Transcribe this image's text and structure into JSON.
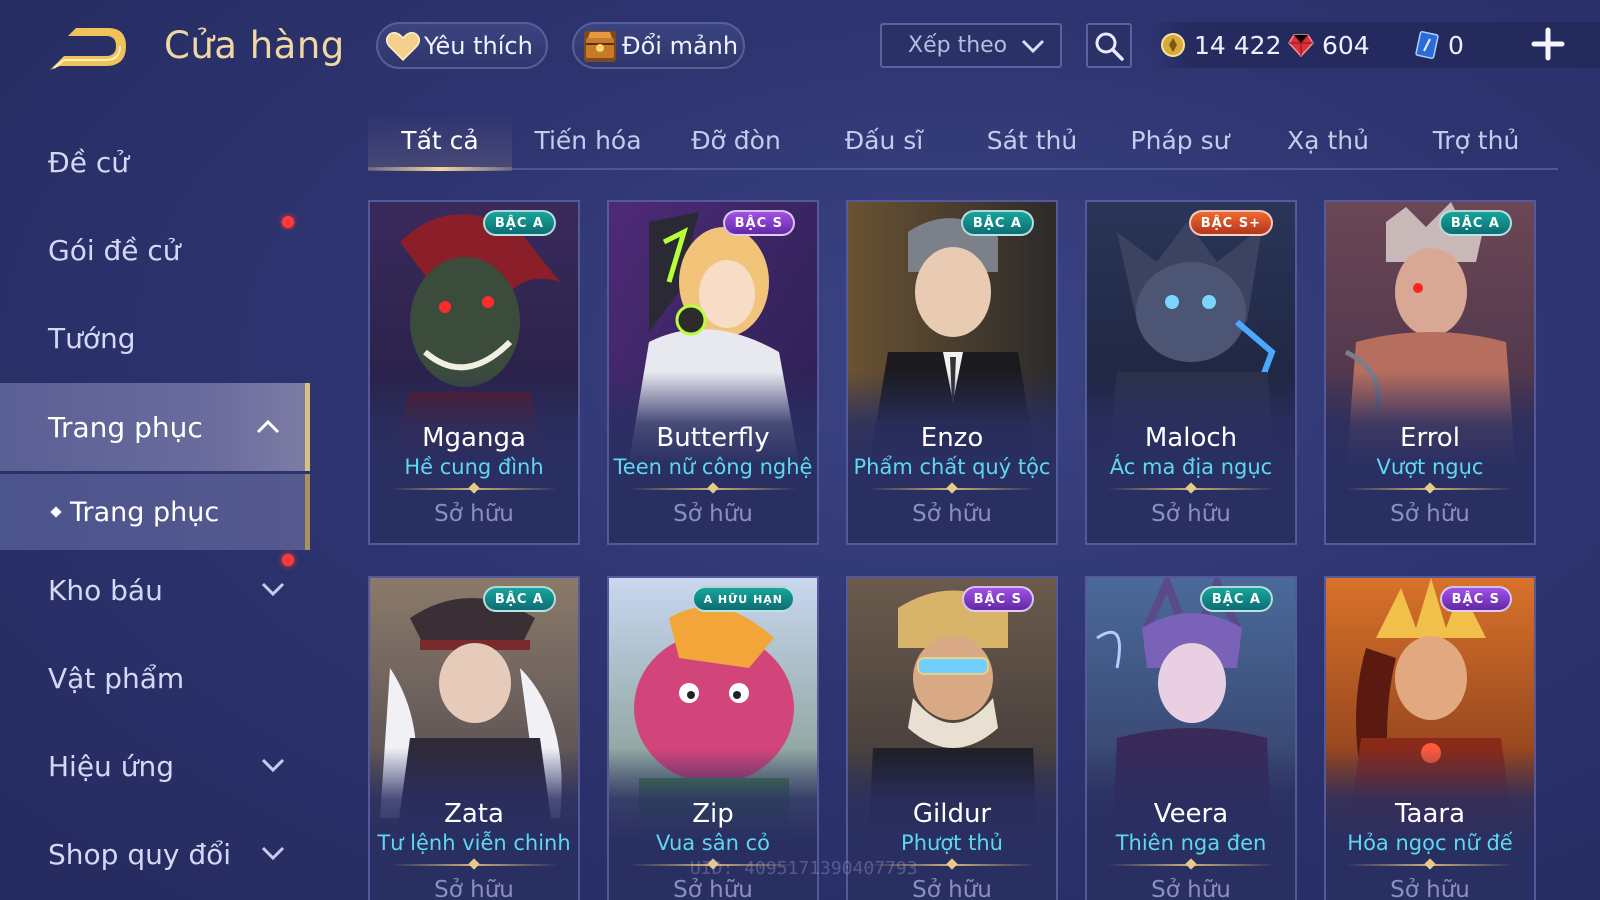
{
  "header": {
    "title": "Cửa hàng",
    "favorites_label": "Yêu thích",
    "fragments_label": "Đổi mảnh",
    "sort_placeholder": "Xếp theo",
    "gold": "14 422",
    "ruby": "604",
    "voucher": "0"
  },
  "sidebar": {
    "items": [
      {
        "label": "Đề cử"
      },
      {
        "label": "Gói đề cử"
      },
      {
        "label": "Tướng"
      },
      {
        "label": "Trang phục"
      },
      {
        "label": "Kho báu"
      },
      {
        "label": "Vật phẩm"
      },
      {
        "label": "Hiệu ứng"
      },
      {
        "label": "Shop quy đổi"
      }
    ],
    "sub_active": "Trang phục"
  },
  "tabs": [
    "Tất cả",
    "Tiến hóa",
    "Đỡ đòn",
    "Đấu sĩ",
    "Sát thủ",
    "Pháp sư",
    "Xạ thủ",
    "Trợ thủ"
  ],
  "cards": [
    {
      "hero": "Mganga",
      "skin": "Hề cung đình",
      "tier": "BẬC A",
      "status": "Sở hữu"
    },
    {
      "hero": "Butterfly",
      "skin": "Teen nữ công nghệ",
      "tier": "BẬC S",
      "status": "Sở hữu"
    },
    {
      "hero": "Enzo",
      "skin": "Phẩm chất quý tộc",
      "tier": "BẬC A",
      "status": "Sở hữu"
    },
    {
      "hero": "Maloch",
      "skin": "Ác ma địa ngục",
      "tier": "BẬC S+",
      "status": "Sở hữu"
    },
    {
      "hero": "Errol",
      "skin": "Vượt ngục",
      "tier": "BẬC A",
      "status": "Sở hữu"
    },
    {
      "hero": "Zata",
      "skin": "Tư lệnh viễn chinh",
      "tier": "BẬC A",
      "status": "Sở hữu"
    },
    {
      "hero": "Zip",
      "skin": "Vua sân cỏ",
      "tier": "A HỮU HẠN",
      "status": "Sở hữu"
    },
    {
      "hero": "Gildur",
      "skin": "Phượt thủ",
      "tier": "BẬC S",
      "status": "Sở hữu"
    },
    {
      "hero": "Veera",
      "skin": "Thiên nga đen",
      "tier": "BẬC A",
      "status": "Sở hữu"
    },
    {
      "hero": "Taara",
      "skin": "Hỏa ngọc nữ đế",
      "tier": "BẬC S",
      "status": "Sở hữu"
    }
  ],
  "uid_text": "UID: 4095171390407793",
  "colors": {
    "accent_gold": "#f0d7a3",
    "skin_name": "#5ed8ef",
    "notification": "#ff3a3a"
  }
}
